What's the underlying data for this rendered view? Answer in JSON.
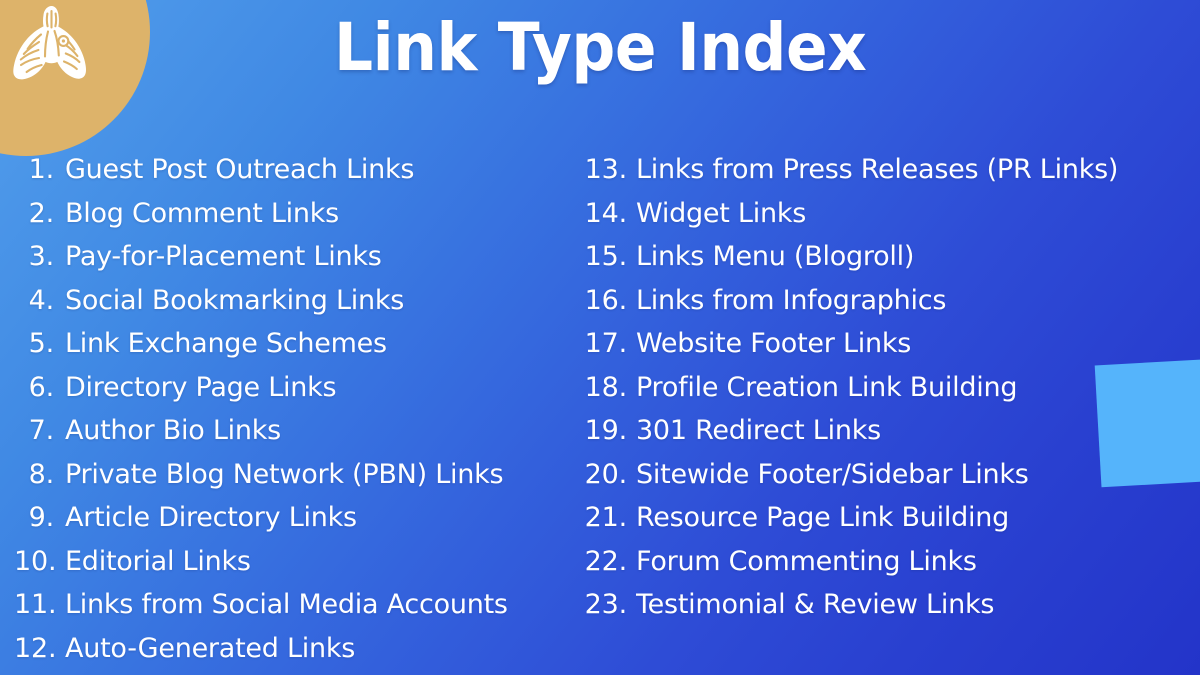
{
  "title": "Link Type Index",
  "brand": {
    "logo_icon": "zebra-head-icon",
    "gold_color": "#ddb36a",
    "accent_square_color": "#55b4fb",
    "gradient_from": "#54a0ec",
    "gradient_to": "#2334c9",
    "text_color": "#ffffff"
  },
  "list": {
    "left_column": [
      {
        "number": "1.",
        "label": "Guest Post Outreach Links"
      },
      {
        "number": "2.",
        "label": "Blog Comment Links"
      },
      {
        "number": "3.",
        "label": "Pay-for-Placement Links"
      },
      {
        "number": "4.",
        "label": "Social Bookmarking Links"
      },
      {
        "number": "5.",
        "label": "Link Exchange Schemes"
      },
      {
        "number": "6.",
        "label": "Directory Page Links"
      },
      {
        "number": "7.",
        "label": "Author Bio Links"
      },
      {
        "number": "8.",
        "label": "Private Blog Network (PBN) Links"
      },
      {
        "number": "9.",
        "label": "Article Directory Links"
      },
      {
        "number": "10.",
        "label": "Editorial Links"
      },
      {
        "number": "11.",
        "label": "Links from Social Media Accounts"
      },
      {
        "number": "12.",
        "label": "Auto-Generated Links"
      }
    ],
    "right_column": [
      {
        "number": "13.",
        "label": "Links from Press Releases (PR Links)"
      },
      {
        "number": "14.",
        "label": "Widget Links"
      },
      {
        "number": "15.",
        "label": "Links Menu (Blogroll)"
      },
      {
        "number": "16.",
        "label": "Links from Infographics"
      },
      {
        "number": "17.",
        "label": "Website Footer Links"
      },
      {
        "number": "18.",
        "label": "Profile Creation Link Building"
      },
      {
        "number": "19.",
        "label": "301 Redirect Links"
      },
      {
        "number": "20.",
        "label": "Sitewide Footer/Sidebar Links"
      },
      {
        "number": "21.",
        "label": "Resource Page Link Building"
      },
      {
        "number": "22.",
        "label": "Forum Commenting Links"
      },
      {
        "number": "23.",
        "label": "Testimonial & Review Links"
      }
    ]
  }
}
